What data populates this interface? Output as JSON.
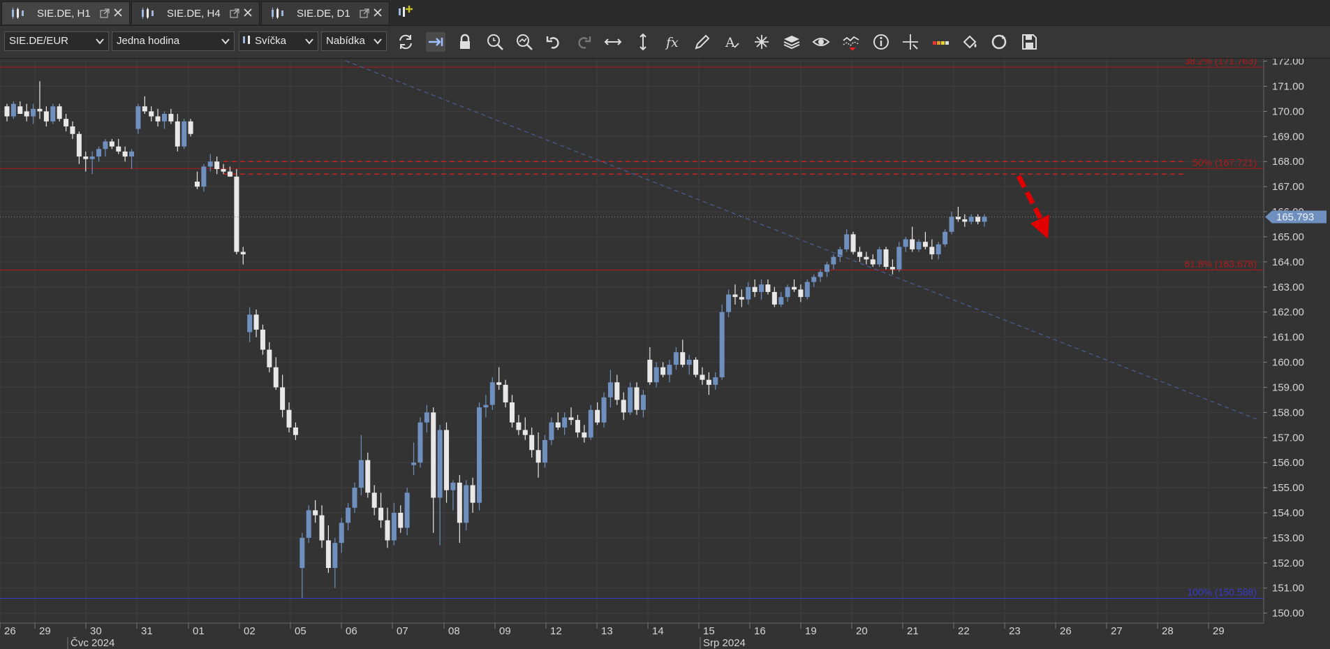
{
  "tabs": [
    {
      "label": "SIE.DE, H1",
      "active": true
    },
    {
      "label": "SIE.DE, H4",
      "active": false
    },
    {
      "label": "SIE.DE, D1",
      "active": false
    }
  ],
  "toolbar": {
    "instrument": "SIE.DE/EUR",
    "period": "Jedna hodina",
    "chart_type": "Svíčka",
    "price_side": "Nabídka",
    "icons": [
      "refresh-icon",
      "autoshift-icon",
      "lock-icon",
      "zoom-in-icon",
      "zoom-out-icon",
      "undo-icon",
      "redo-icon",
      "horizontal-scale-icon",
      "vertical-scale-icon",
      "indicators-fx-icon",
      "pencil-icon",
      "text-icon",
      "patterns-icon",
      "layers-icon",
      "eye-icon",
      "compare-icon",
      "info-icon",
      "crosshair-icon",
      "volume-icon",
      "paint-icon",
      "refresh-circle-icon",
      "save-icon"
    ]
  },
  "colors": {
    "bg": "#333333",
    "grid": "#3f3f3f",
    "bull": "#6f8fbe",
    "bear": "#e8e8e8",
    "fib_red": "#b21a1a",
    "fib_blue": "#3a3acc",
    "price_tag": "#6f8fbe",
    "arrow": "#e00000"
  },
  "chart_data": {
    "type": "candlestick",
    "y_ticks": [
      "172.00",
      "171.00",
      "170.00",
      "169.00",
      "168.00",
      "167.00",
      "166.00",
      "165.00",
      "164.00",
      "163.00",
      "162.00",
      "161.00",
      "160.00",
      "159.00",
      "158.00",
      "157.00",
      "156.00",
      "155.00",
      "154.00",
      "153.00",
      "152.00",
      "151.00",
      "150.00"
    ],
    "ylim": [
      149.6,
      172.1
    ],
    "x_ticks": [
      "26",
      "29",
      "30",
      "31",
      "01",
      "02",
      "05",
      "06",
      "07",
      "08",
      "09",
      "12",
      "13",
      "14",
      "15",
      "16",
      "19",
      "20",
      "21",
      "22",
      "23",
      "26",
      "27",
      "28",
      "29"
    ],
    "month_labels": [
      "Čvc 2024",
      "Srp 2024"
    ],
    "current_price": "165.793",
    "fib_levels": [
      {
        "label": "38.2% (171.763)",
        "value": 171.763,
        "color": "red"
      },
      {
        "label": "50% (167.721)",
        "value": 167.721,
        "color": "red"
      },
      {
        "label": "61.8% (163.678)",
        "value": 163.678,
        "color": "red"
      },
      {
        "label": "100% (150.588)",
        "value": 150.588,
        "color": "blue"
      }
    ],
    "candles": [
      [
        170.2,
        170.3,
        169.6,
        169.8
      ],
      [
        169.8,
        170.4,
        169.7,
        170.3
      ],
      [
        170.2,
        170.4,
        169.9,
        169.9
      ],
      [
        170.0,
        170.3,
        169.6,
        169.8
      ],
      [
        169.8,
        170.3,
        169.5,
        170.1
      ],
      [
        170.1,
        171.2,
        169.7,
        170.0
      ],
      [
        170.0,
        170.2,
        169.4,
        169.6
      ],
      [
        169.6,
        170.3,
        169.5,
        170.2
      ],
      [
        170.2,
        170.3,
        169.6,
        169.7
      ],
      [
        169.7,
        169.9,
        169.2,
        169.4
      ],
      [
        169.4,
        169.6,
        168.9,
        169.1
      ],
      [
        169.1,
        169.2,
        167.9,
        168.2
      ],
      [
        168.2,
        168.4,
        167.6,
        168.1
      ],
      [
        168.1,
        168.4,
        167.5,
        168.2
      ],
      [
        168.2,
        168.6,
        168.0,
        168.5
      ],
      [
        168.5,
        168.9,
        168.2,
        168.8
      ],
      [
        168.8,
        168.9,
        168.5,
        168.6
      ],
      [
        168.6,
        168.9,
        168.3,
        168.4
      ],
      [
        168.4,
        168.6,
        168.0,
        168.2
      ],
      [
        168.2,
        168.5,
        167.7,
        168.4
      ],
      [
        169.3,
        170.3,
        169.1,
        170.2
      ],
      [
        170.2,
        170.6,
        169.9,
        170.0
      ],
      [
        170.0,
        170.2,
        169.6,
        169.8
      ],
      [
        169.8,
        170.1,
        169.4,
        169.6
      ],
      [
        169.6,
        170.0,
        169.3,
        169.9
      ],
      [
        169.9,
        170.1,
        169.5,
        169.6
      ],
      [
        169.6,
        169.9,
        168.4,
        168.6
      ],
      [
        168.6,
        169.7,
        168.5,
        169.6
      ],
      [
        169.6,
        169.7,
        169.0,
        169.1
      ],
      [
        167.2,
        167.6,
        166.9,
        167.0
      ],
      [
        167.0,
        167.9,
        166.8,
        167.8
      ],
      [
        167.8,
        168.3,
        167.6,
        168.0
      ],
      [
        168.0,
        168.2,
        167.5,
        167.7
      ],
      [
        167.7,
        167.9,
        167.5,
        167.6
      ],
      [
        167.6,
        167.8,
        167.4,
        167.4
      ],
      [
        167.4,
        167.7,
        164.3,
        164.4
      ],
      [
        164.4,
        164.6,
        163.9,
        164.3
      ],
      [
        161.2,
        162.2,
        160.8,
        161.9
      ],
      [
        161.9,
        162.1,
        161.0,
        161.3
      ],
      [
        161.3,
        161.5,
        160.3,
        160.5
      ],
      [
        160.5,
        160.8,
        159.6,
        159.8
      ],
      [
        159.8,
        160.2,
        158.9,
        159.0
      ],
      [
        159.0,
        159.5,
        157.8,
        158.1
      ],
      [
        158.1,
        158.4,
        157.2,
        157.4
      ],
      [
        157.4,
        157.6,
        156.9,
        157.1
      ],
      [
        151.8,
        153.2,
        150.6,
        153.0
      ],
      [
        153.0,
        154.3,
        152.8,
        154.1
      ],
      [
        154.1,
        154.5,
        153.6,
        153.9
      ],
      [
        153.9,
        154.3,
        152.6,
        152.9
      ],
      [
        152.9,
        153.5,
        151.6,
        151.8
      ],
      [
        151.8,
        153.0,
        151.0,
        152.8
      ],
      [
        152.8,
        153.8,
        152.4,
        153.6
      ],
      [
        153.6,
        154.4,
        153.3,
        154.2
      ],
      [
        154.2,
        155.2,
        154.0,
        155.0
      ],
      [
        155.0,
        157.1,
        154.7,
        156.1
      ],
      [
        156.1,
        156.4,
        154.6,
        154.8
      ],
      [
        154.8,
        155.1,
        153.9,
        154.2
      ],
      [
        154.2,
        154.8,
        153.4,
        153.7
      ],
      [
        153.7,
        154.2,
        152.6,
        152.9
      ],
      [
        152.9,
        154.4,
        152.7,
        154.0
      ],
      [
        154.0,
        154.3,
        153.2,
        153.4
      ],
      [
        153.4,
        155.0,
        153.1,
        154.8
      ],
      [
        155.9,
        156.8,
        155.5,
        156.0
      ],
      [
        156.0,
        157.8,
        155.8,
        157.6
      ],
      [
        157.6,
        158.3,
        157.2,
        158.0
      ],
      [
        158.0,
        158.2,
        153.2,
        154.6
      ],
      [
        154.6,
        157.5,
        152.7,
        157.3
      ],
      [
        157.3,
        157.6,
        154.4,
        154.9
      ],
      [
        154.9,
        155.3,
        154.1,
        155.2
      ],
      [
        155.2,
        155.5,
        152.8,
        153.6
      ],
      [
        153.6,
        155.3,
        153.3,
        155.1
      ],
      [
        155.1,
        155.4,
        154.0,
        154.4
      ],
      [
        154.4,
        158.4,
        154.1,
        158.2
      ],
      [
        158.2,
        158.7,
        157.8,
        158.3
      ],
      [
        158.3,
        159.4,
        158.1,
        159.2
      ],
      [
        159.2,
        159.8,
        158.9,
        159.1
      ],
      [
        159.1,
        159.3,
        158.2,
        158.4
      ],
      [
        158.4,
        158.7,
        157.4,
        157.6
      ],
      [
        157.6,
        157.9,
        157.1,
        157.3
      ],
      [
        157.3,
        157.8,
        156.9,
        157.1
      ],
      [
        157.1,
        157.4,
        156.2,
        156.5
      ],
      [
        156.5,
        157.2,
        155.4,
        156.0
      ],
      [
        156.0,
        157.1,
        155.8,
        156.9
      ],
      [
        156.9,
        157.8,
        156.7,
        157.6
      ],
      [
        157.6,
        158.0,
        157.3,
        157.4
      ],
      [
        157.4,
        158.0,
        157.1,
        157.8
      ],
      [
        157.8,
        158.2,
        157.5,
        157.7
      ],
      [
        157.7,
        157.9,
        157.0,
        157.2
      ],
      [
        157.2,
        157.5,
        156.8,
        157.0
      ],
      [
        157.0,
        158.3,
        156.9,
        158.1
      ],
      [
        158.1,
        158.4,
        157.5,
        157.6
      ],
      [
        157.6,
        158.8,
        157.4,
        158.6
      ],
      [
        158.6,
        159.7,
        158.2,
        159.2
      ],
      [
        159.2,
        159.5,
        158.3,
        158.5
      ],
      [
        158.5,
        158.8,
        157.7,
        158.0
      ],
      [
        158.0,
        159.2,
        157.9,
        159.0
      ],
      [
        159.0,
        159.2,
        157.9,
        158.1
      ],
      [
        158.1,
        158.9,
        157.8,
        158.7
      ],
      [
        160.1,
        160.6,
        159.1,
        159.2
      ],
      [
        159.2,
        160.0,
        159.0,
        159.8
      ],
      [
        159.8,
        160.0,
        159.4,
        159.5
      ],
      [
        159.5,
        160.1,
        159.2,
        159.9
      ],
      [
        159.9,
        160.6,
        159.7,
        160.4
      ],
      [
        160.4,
        160.9,
        159.8,
        159.9
      ],
      [
        159.9,
        160.3,
        159.5,
        160.1
      ],
      [
        160.1,
        160.2,
        159.4,
        159.5
      ],
      [
        159.5,
        159.8,
        159.1,
        159.3
      ],
      [
        159.3,
        159.6,
        158.7,
        159.1
      ],
      [
        159.1,
        159.6,
        158.9,
        159.4
      ],
      [
        159.4,
        162.3,
        159.3,
        162.0
      ],
      [
        162.0,
        162.9,
        161.8,
        162.7
      ],
      [
        162.7,
        163.1,
        162.3,
        162.6
      ],
      [
        162.6,
        162.9,
        162.2,
        162.5
      ],
      [
        162.5,
        163.2,
        162.3,
        163.0
      ],
      [
        163.0,
        163.3,
        162.6,
        162.8
      ],
      [
        162.8,
        163.3,
        162.5,
        163.1
      ],
      [
        163.1,
        163.3,
        162.7,
        162.8
      ],
      [
        162.8,
        163.0,
        162.2,
        162.3
      ],
      [
        162.3,
        162.8,
        162.2,
        162.6
      ],
      [
        162.6,
        163.1,
        162.4,
        163.0
      ],
      [
        163.0,
        163.3,
        162.8,
        162.9
      ],
      [
        162.9,
        163.1,
        162.4,
        162.6
      ],
      [
        162.6,
        163.3,
        162.5,
        163.2
      ],
      [
        163.2,
        163.5,
        163.0,
        163.4
      ],
      [
        163.4,
        163.7,
        163.2,
        163.6
      ],
      [
        163.6,
        164.0,
        163.4,
        163.9
      ],
      [
        163.9,
        164.3,
        163.7,
        164.2
      ],
      [
        164.2,
        164.6,
        164.0,
        164.5
      ],
      [
        164.5,
        165.3,
        164.4,
        165.1
      ],
      [
        165.1,
        165.2,
        164.3,
        164.4
      ],
      [
        164.4,
        164.6,
        164.0,
        164.2
      ],
      [
        164.2,
        164.4,
        163.9,
        164.1
      ],
      [
        164.1,
        164.3,
        163.8,
        163.9
      ],
      [
        163.9,
        164.6,
        163.8,
        164.5
      ],
      [
        164.5,
        164.6,
        163.7,
        163.8
      ],
      [
        163.8,
        164.1,
        163.5,
        163.7
      ],
      [
        163.7,
        164.8,
        163.6,
        164.6
      ],
      [
        164.6,
        165.0,
        164.4,
        164.9
      ],
      [
        164.9,
        165.4,
        164.4,
        164.5
      ],
      [
        164.5,
        164.9,
        164.4,
        164.8
      ],
      [
        164.8,
        165.2,
        164.5,
        164.6
      ],
      [
        164.6,
        164.9,
        164.1,
        164.3
      ],
      [
        164.3,
        164.8,
        164.1,
        164.7
      ],
      [
        164.7,
        165.3,
        164.6,
        165.2
      ],
      [
        165.2,
        166.0,
        165.1,
        165.8
      ],
      [
        165.8,
        166.2,
        165.6,
        165.7
      ],
      [
        165.7,
        165.9,
        165.4,
        165.6
      ],
      [
        165.6,
        165.9,
        165.5,
        165.8
      ],
      [
        165.8,
        165.9,
        165.5,
        165.6
      ],
      [
        165.6,
        165.9,
        165.4,
        165.8
      ]
    ]
  }
}
